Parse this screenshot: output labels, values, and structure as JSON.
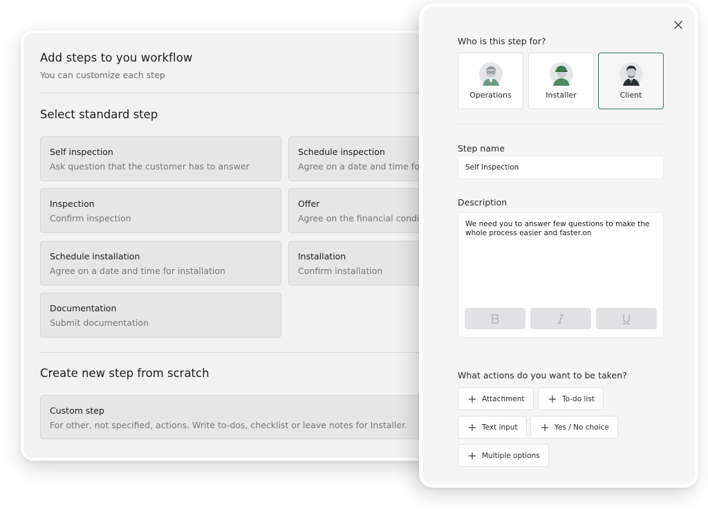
{
  "workflow": {
    "title": "Add steps to you workflow",
    "subtitle": "You can customize each step",
    "standard_heading": "Select standard step",
    "scratch_heading": "Create new step from scratch",
    "steps": [
      {
        "title": "Self inspection",
        "description": "Ask question that the customer has to answer"
      },
      {
        "title": "Schedule inspection",
        "description": "Agree on a date and time for inspection"
      },
      {
        "title": "Inspection",
        "description": "Confirm inspection"
      },
      {
        "title": "Offer",
        "description": "Agree on the financial conditions"
      },
      {
        "title": "Schedule installation",
        "description": "Agree on a date and time for installation"
      },
      {
        "title": "Installation",
        "description": "Confirm installation"
      },
      {
        "title": "Documentation",
        "description": "Submit documentation"
      }
    ],
    "custom_step": {
      "title": "Custom step",
      "description": "For other, not specified, actions. Write to-dos, checklist or leave notes for Installer."
    }
  },
  "panel": {
    "who_label": "Who is this step for?",
    "roles": [
      {
        "label": "Operations",
        "icon": "operations-avatar",
        "selected": false
      },
      {
        "label": "Installer",
        "icon": "installer-avatar",
        "selected": false
      },
      {
        "label": "Client",
        "icon": "client-avatar",
        "selected": true
      }
    ],
    "step_name_label": "Step name",
    "step_name_value": "Self Inspection",
    "description_label": "Description",
    "description_value": "We need you to answer few questions to make the whole process easier and faster.on",
    "format_buttons": [
      "B",
      "I",
      "U"
    ],
    "actions_label": "What actions do you want to be taken?",
    "actions": [
      "Attachment",
      "To-do list",
      "Text input",
      "Yes / No choice",
      "Multiple options"
    ]
  },
  "colors": {
    "selected_border": "#3d7a5b",
    "card_bg": "#e6e6e7",
    "panel_bg": "#f5f5f5"
  }
}
